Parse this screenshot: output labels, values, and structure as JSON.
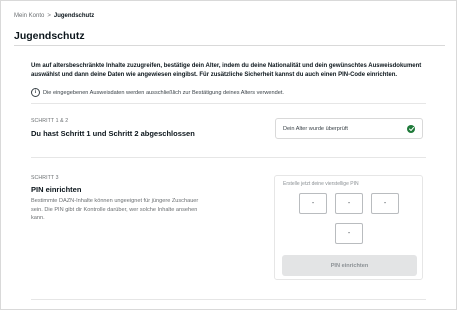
{
  "breadcrumb": {
    "parent": "Mein Konto",
    "separator": ">",
    "current": "Jugendschutz"
  },
  "page": {
    "title": "Jugendschutz"
  },
  "intro": {
    "text": "Um auf altersbeschränkte Inhalte zuzugreifen, bestätige dein Alter, indem du deine Nationalität und dein gewünschtes Ausweisdokument auswählst und dann deine Daten wie angewiesen eingibst. Für zusätzliche Sicherheit kannst du auch einen PIN-Code einrichten.",
    "info_icon": "info-circle-icon",
    "info_text": "Die eingegebenen Ausweisdaten werden ausschließlich zur Bestätigung deines Alters verwendet."
  },
  "steps_1_2": {
    "label": "SCHRITT 1 & 2",
    "heading": "Du hast Schritt 1 und Schritt 2 abgeschlossen",
    "status_text": "Dein Alter wurde überprüft",
    "status_icon": "check-circle-icon",
    "status_color": "#1f7a3a"
  },
  "step_3": {
    "label": "SCHRITT 3",
    "heading": "PIN einrichten",
    "description": "Bestimmte DAZN-Inhalte können ungeeignet für jüngere Zuschauer sein. Die PIN gibt dir Kontrolle darüber, wer solche Inhalte ansehen kann.",
    "pin_label": "Erstelle jetzt deine vierstellige PIN",
    "pin_digits": [
      "-",
      "-",
      "-",
      "-"
    ],
    "submit_label": "PIN einrichten"
  }
}
